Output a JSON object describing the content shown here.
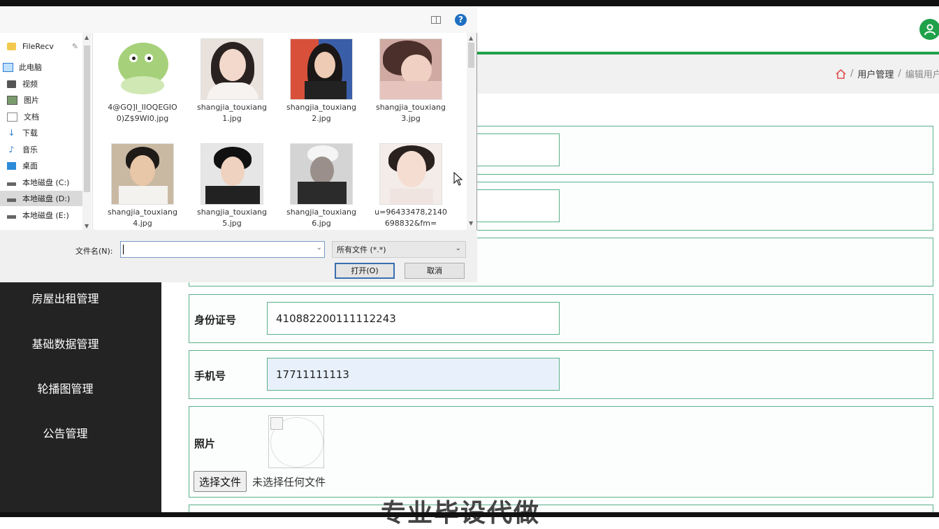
{
  "header": {
    "breadcrumb": [
      "用户管理",
      "编辑用户"
    ]
  },
  "sidebar": {
    "items": [
      {
        "label": "房屋出租管理"
      },
      {
        "label": "基础数据管理"
      },
      {
        "label": "轮播图管理"
      },
      {
        "label": "公告管理"
      }
    ]
  },
  "form": {
    "id_label": "身份证号",
    "id_value": "410882200111112243",
    "phone_label": "手机号",
    "phone_value": "17711111113",
    "photo_label": "照片",
    "file_button": "选择文件",
    "file_status": "未选择任何文件"
  },
  "watermark": "专业毕设代做",
  "dialog": {
    "nav": [
      {
        "label": "FileRecv",
        "icon": "folder-icon"
      },
      {
        "label": "此电脑",
        "icon": "computer-icon"
      },
      {
        "label": "视频",
        "icon": "video-icon"
      },
      {
        "label": "图片",
        "icon": "pictures-icon"
      },
      {
        "label": "文档",
        "icon": "documents-icon"
      },
      {
        "label": "下载",
        "icon": "download-icon"
      },
      {
        "label": "音乐",
        "icon": "music-icon"
      },
      {
        "label": "桌面",
        "icon": "desktop-icon"
      },
      {
        "label": "本地磁盘 (C:)",
        "icon": "drive-icon"
      },
      {
        "label": "本地磁盘 (D:)",
        "icon": "drive-icon"
      },
      {
        "label": "本地磁盘 (E:)",
        "icon": "drive-icon"
      }
    ],
    "files": [
      {
        "name": "4@GQ]I_IIOQEGIO0)Z$9WI0.jpg"
      },
      {
        "name": "shangjia_touxiang1.jpg"
      },
      {
        "name": "shangjia_touxiang2.jpg"
      },
      {
        "name": "shangjia_touxiang3.jpg"
      },
      {
        "name": "shangjia_touxiang4.jpg"
      },
      {
        "name": "shangjia_touxiang5.jpg"
      },
      {
        "name": "shangjia_touxiang6.jpg"
      },
      {
        "name": "u=96433478,2140698832&fm="
      }
    ],
    "filename_label": "文件名(N):",
    "filename_value": "",
    "filetype": "所有文件 (*.*)",
    "open_button": "打开(O)",
    "cancel_button": "取消",
    "help_glyph": "?"
  }
}
